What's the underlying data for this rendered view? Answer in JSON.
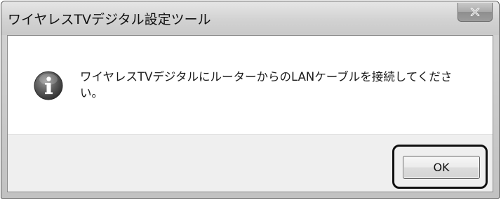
{
  "window": {
    "title": "ワイヤレスTVデジタル設定ツール"
  },
  "titlebar": {
    "close_icon": "close-x-icon"
  },
  "dialog": {
    "icon": "info-icon",
    "message": "ワイヤレスTVデジタルにルーターからのLANケーブルを接続してください。"
  },
  "footer": {
    "ok_label": "OK"
  },
  "colors": {
    "highlight_border": "#111111",
    "footer_bg": "#efefef",
    "close_button": "#9c9c9c"
  }
}
